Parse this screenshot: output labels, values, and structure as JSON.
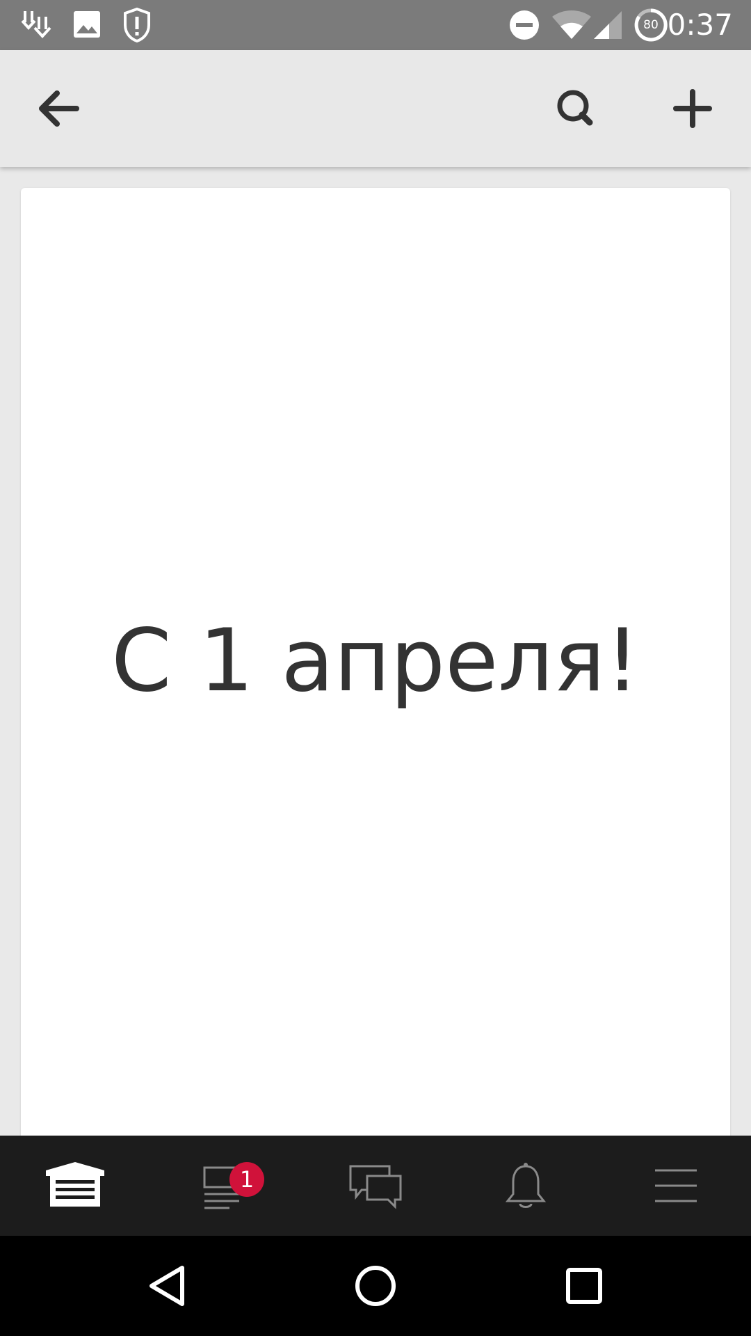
{
  "status_bar": {
    "time": "0:37",
    "battery_level": "80",
    "icons": [
      "download-icon",
      "image-icon",
      "shield-alert-icon",
      "do-not-disturb-icon",
      "wifi-icon",
      "signal-icon",
      "battery-icon"
    ]
  },
  "toolbar": {
    "icons": [
      "back-arrow-icon",
      "search-icon",
      "add-icon"
    ]
  },
  "content": {
    "title": "С 1 апреля!"
  },
  "tabbar": {
    "active_index": 0,
    "items": [
      {
        "icon": "garage-icon"
      },
      {
        "icon": "feed-icon",
        "badge": "1"
      },
      {
        "icon": "chat-icon"
      },
      {
        "icon": "bell-icon"
      },
      {
        "icon": "menu-icon"
      }
    ]
  },
  "navbar": {
    "icons": [
      "nav-back-icon",
      "nav-home-icon",
      "nav-recents-icon"
    ]
  },
  "colors": {
    "status_bar": "#7b7b7b",
    "toolbar": "#e8e8e8",
    "background": "#e9e9e9",
    "tabbar": "#1c1c1c",
    "badge": "#d0123a"
  }
}
